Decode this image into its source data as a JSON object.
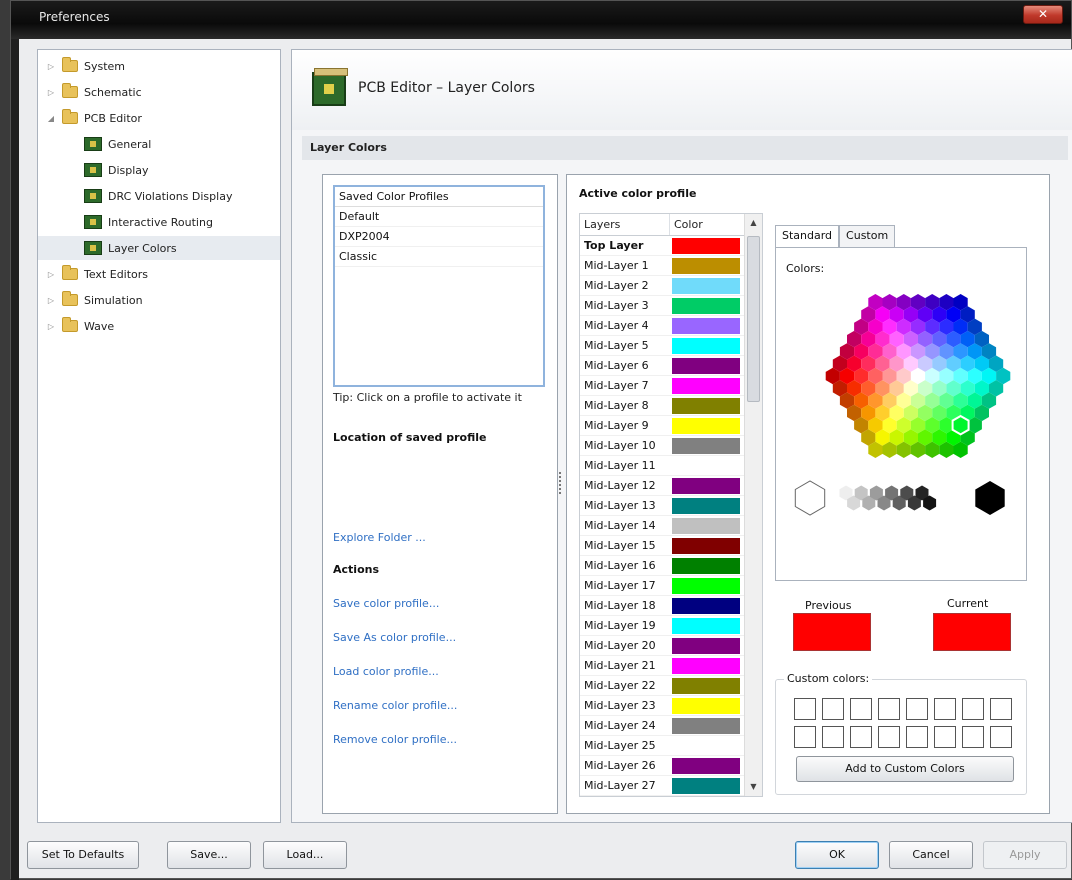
{
  "window": {
    "title": "Preferences",
    "close_label": "✕"
  },
  "tree": {
    "items": [
      {
        "label": "System",
        "expanded": false,
        "type": "folder"
      },
      {
        "label": "Schematic",
        "expanded": false,
        "type": "folder"
      },
      {
        "label": "PCB Editor",
        "expanded": true,
        "type": "folder"
      },
      {
        "label": "General",
        "type": "pcb"
      },
      {
        "label": "Display",
        "type": "pcb"
      },
      {
        "label": "DRC Violations Display",
        "type": "pcb"
      },
      {
        "label": "Interactive Routing",
        "type": "pcb"
      },
      {
        "label": "Layer Colors",
        "type": "pcb",
        "selected": true
      },
      {
        "label": "Text Editors",
        "expanded": false,
        "type": "folder"
      },
      {
        "label": "Simulation",
        "expanded": false,
        "type": "folder"
      },
      {
        "label": "Wave",
        "expanded": false,
        "type": "folder"
      }
    ]
  },
  "page": {
    "title": "PCB Editor – Layer Colors",
    "section": "Layer Colors"
  },
  "profiles": {
    "header": "Saved Color Profiles",
    "items": [
      "Default",
      "DXP2004",
      "Classic"
    ],
    "tip": "Tip: Click on a profile to activate it",
    "location_title": "Location of saved profile",
    "explore_link": "Explore Folder ...",
    "actions_title": "Actions",
    "actions": [
      "Save color profile...",
      "Save As color profile...",
      "Load color profile...",
      "Rename color profile...",
      "Remove color profile..."
    ]
  },
  "active_profile": {
    "title": "Active color profile",
    "col_layers": "Layers",
    "col_color": "Color",
    "layers": [
      {
        "name": "Top Layer",
        "color": "#ff0000",
        "bold": true
      },
      {
        "name": "Mid-Layer 1",
        "color": "#bc8e00"
      },
      {
        "name": "Mid-Layer 2",
        "color": "#70dbfa"
      },
      {
        "name": "Mid-Layer 3",
        "color": "#00cc66"
      },
      {
        "name": "Mid-Layer 4",
        "color": "#9966ff"
      },
      {
        "name": "Mid-Layer 5",
        "color": "#00ffff"
      },
      {
        "name": "Mid-Layer 6",
        "color": "#800080"
      },
      {
        "name": "Mid-Layer 7",
        "color": "#ff00ff"
      },
      {
        "name": "Mid-Layer 8",
        "color": "#808000"
      },
      {
        "name": "Mid-Layer 9",
        "color": "#ffff00"
      },
      {
        "name": "Mid-Layer 10",
        "color": "#808080"
      },
      {
        "name": "Mid-Layer 11",
        "color": "#ffffff"
      },
      {
        "name": "Mid-Layer 12",
        "color": "#800080"
      },
      {
        "name": "Mid-Layer 13",
        "color": "#008080"
      },
      {
        "name": "Mid-Layer 14",
        "color": "#c0c0c0"
      },
      {
        "name": "Mid-Layer 15",
        "color": "#800000"
      },
      {
        "name": "Mid-Layer 16",
        "color": "#008000"
      },
      {
        "name": "Mid-Layer 17",
        "color": "#00ff00"
      },
      {
        "name": "Mid-Layer 18",
        "color": "#000080"
      },
      {
        "name": "Mid-Layer 19",
        "color": "#00ffff"
      },
      {
        "name": "Mid-Layer 20",
        "color": "#800080"
      },
      {
        "name": "Mid-Layer 21",
        "color": "#ff00ff"
      },
      {
        "name": "Mid-Layer 22",
        "color": "#808000"
      },
      {
        "name": "Mid-Layer 23",
        "color": "#ffff00"
      },
      {
        "name": "Mid-Layer 24",
        "color": "#808080"
      },
      {
        "name": "Mid-Layer 25",
        "color": "#ffffff"
      },
      {
        "name": "Mid-Layer 26",
        "color": "#800080"
      },
      {
        "name": "Mid-Layer 27",
        "color": "#008080"
      }
    ]
  },
  "color_dialog": {
    "tab_standard": "Standard",
    "tab_custom": "Custom",
    "colors_label": "Colors:",
    "previous_label": "Previous",
    "current_label": "Current",
    "previous_color": "#ff0000",
    "current_color": "#ff0000",
    "custom_colors_label": "Custom colors:",
    "add_button": "Add to Custom Colors"
  },
  "footer": {
    "set_defaults": "Set To Defaults",
    "save": "Save...",
    "load": "Load...",
    "ok": "OK",
    "cancel": "Cancel",
    "apply": "Apply"
  }
}
